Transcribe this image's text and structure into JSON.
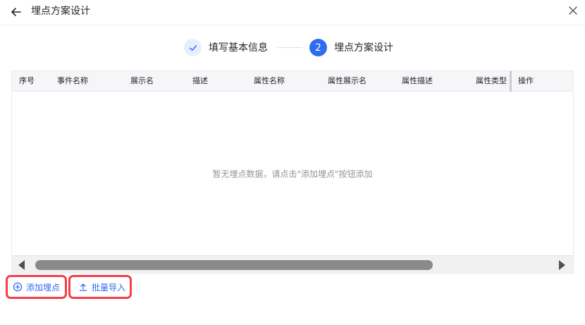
{
  "header": {
    "title": "埋点方案设计",
    "back_icon": "arrow-left-icon",
    "close_icon": "close-icon"
  },
  "steps": [
    {
      "label": "填写基本信息",
      "status": "completed",
      "icon": "check-icon"
    },
    {
      "label": "埋点方案设计",
      "status": "active",
      "number": "2"
    }
  ],
  "table": {
    "columns": [
      "序号",
      "事件名称",
      "展示名",
      "描述",
      "属性名称",
      "属性展示名",
      "属性描述",
      "属性类型",
      "操作"
    ],
    "empty_text": "暂无埋点数据，请点击\"添加埋点\"按钮添加"
  },
  "actions": {
    "add_label": "添加埋点",
    "import_label": "批量导入"
  },
  "colors": {
    "primary": "#2f6cf0",
    "highlight_border": "#f23f4a"
  }
}
